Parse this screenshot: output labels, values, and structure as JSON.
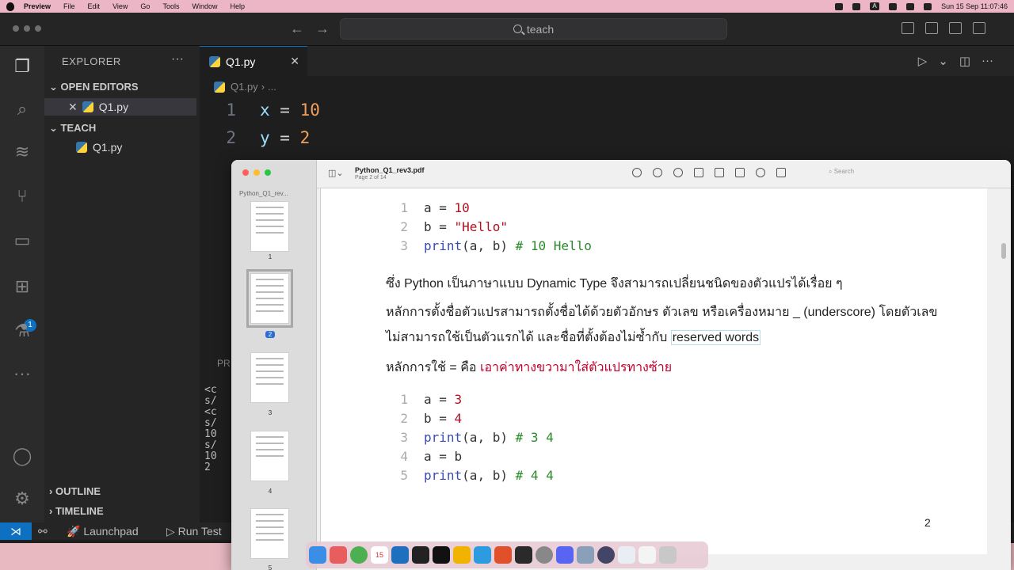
{
  "menubar": {
    "app": "Preview",
    "items": [
      "File",
      "Edit",
      "View",
      "Go",
      "Tools",
      "Window",
      "Help"
    ],
    "clock": "Sun 15 Sep  11:07:46",
    "input_source": "A"
  },
  "vscode": {
    "search_text": "teach",
    "explorer_title": "EXPLORER",
    "open_editors_label": "OPEN EDITORS",
    "open_editor_file": "Q1.py",
    "folder_label": "TEACH",
    "folder_file": "Q1.py",
    "tab_label": "Q1.py",
    "breadcrumb_file": "Q1.py",
    "breadcrumb_more": "...",
    "extensions_badge": "1",
    "code_lines": [
      {
        "n": "1",
        "var": "x",
        "op": " = ",
        "val": "10"
      },
      {
        "n": "2",
        "var": "y",
        "op": " = ",
        "val": "2"
      }
    ],
    "panel_label": "PR",
    "panel_lines": [
      "<c",
      "s/",
      "<c",
      "s/",
      "10",
      "s/",
      "10",
      "2 "
    ],
    "outline_label": "OUTLINE",
    "timeline_label": "TIMELINE",
    "status_launchpad": "Launchpad",
    "status_run": "Run Test"
  },
  "preview": {
    "sidebar_title": "Python_Q1_rev...",
    "doc_title": "Python_Q1_rev3.pdf",
    "doc_sub": "Page 2 of 14",
    "search_placeholder": "Search",
    "thumb_numbers": [
      "1",
      "2",
      "3",
      "4",
      "5"
    ],
    "block1": [
      {
        "n": "1",
        "a": "a = ",
        "b": "10",
        "type": "num"
      },
      {
        "n": "2",
        "a": "b = ",
        "b": "\"Hello\"",
        "type": "str"
      },
      {
        "n": "3",
        "a": "print",
        "b": "(a, b) ",
        "c": "# 10 Hello",
        "type": "print"
      }
    ],
    "para1": "ซึ่ง Python เป็นภาษาแบบ Dynamic Type จึงสามารถเปลี่ยนชนิดของตัวแปรได้เรื่อย ๆ",
    "para2": "หลักการตั้งชื่อตัวแปรสามารถตั้งชื่อได้ด้วยตัวอักษร ตัวเลข หรือเครื่องหมาย _ (underscore) โดยตัวเลข",
    "para3_prefix": "ไม่สามารถใช้เป็นตัวแรกได้ และชื่อที่ตั้งต้องไม่ซ้ำกับ ",
    "para3_boxed": "reserved words",
    "para4_prefix": "หลักการใช้ = คือ ",
    "para4_red": "เอาค่าทางขวามาใส่ตัวแปรทางซ้าย",
    "block2": [
      {
        "n": "1",
        "a": "a = ",
        "b": "3",
        "type": "num"
      },
      {
        "n": "2",
        "a": "b = ",
        "b": "4",
        "type": "num"
      },
      {
        "n": "3",
        "a": "print",
        "b": "(a, b) ",
        "c": "# 3 4",
        "type": "print"
      },
      {
        "n": "4",
        "a": "a = b",
        "b": "",
        "type": "plain"
      },
      {
        "n": "5",
        "a": "print",
        "b": "(a, b) ",
        "c": "# 4 4",
        "type": "print"
      }
    ],
    "page_number": "2"
  },
  "dock": {
    "calendar_day": "15"
  }
}
